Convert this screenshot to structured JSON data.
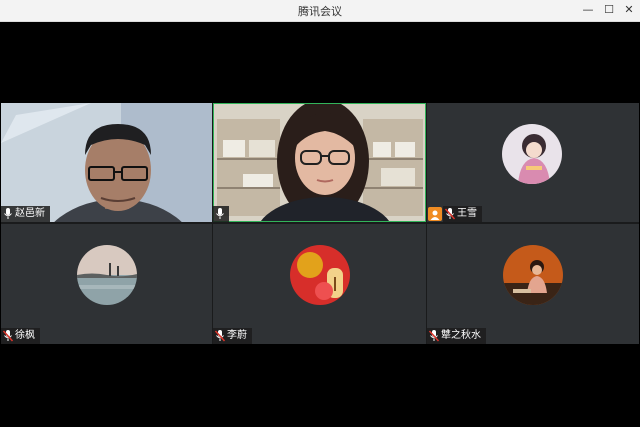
{
  "window": {
    "title": "腾讯会议",
    "minimize": "—",
    "maximize": "☐",
    "close": "✕"
  },
  "participants": [
    {
      "name": "赵邑新",
      "mic": "on",
      "view": "video"
    },
    {
      "name": "",
      "mic": "on",
      "view": "video",
      "speaking": true
    },
    {
      "name": "王雪",
      "mic": "muted",
      "view": "avatar",
      "host": true
    },
    {
      "name": "徐枫",
      "mic": "muted",
      "view": "avatar"
    },
    {
      "name": "李蔚",
      "mic": "muted",
      "view": "avatar"
    },
    {
      "name": "犨之秋水",
      "mic": "muted",
      "view": "avatar"
    }
  ],
  "colors": {
    "tile_bg": "#2f3235",
    "active_border": "#32b45a",
    "host_badge": "#f08c23",
    "muted_mic": "#d9352b"
  }
}
